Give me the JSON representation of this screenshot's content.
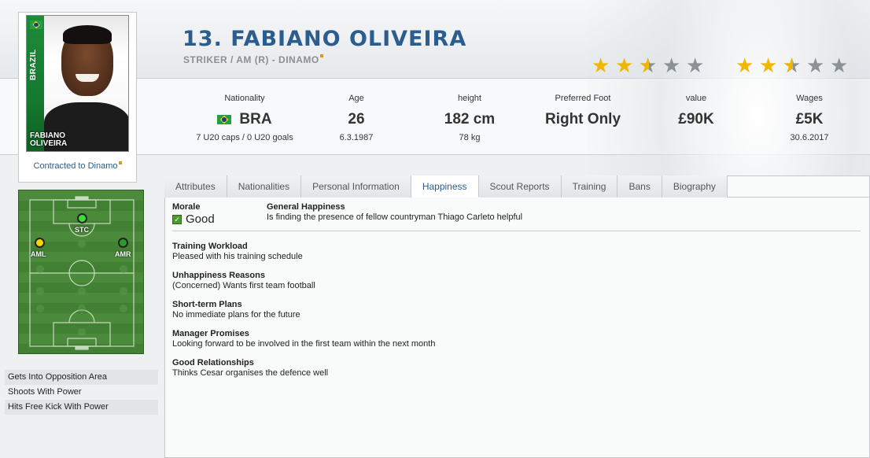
{
  "player": {
    "title": "13. FABIANO OLIVEIRA",
    "subtitle": "STRIKER / AM (R) - DINAMO",
    "photo_name_line1": "FABIANO",
    "photo_name_line2": "OLIVEIRA",
    "photo_country": "BRAZIL",
    "contracted": "Contracted to Dinamo",
    "current_ability_stars": 2.5,
    "potential_ability_stars": 2.5
  },
  "info": {
    "nationality_label": "Nationality",
    "nationality_value": "BRA",
    "nationality_sub": "7 U20 caps / 0 U20 goals",
    "age_label": "Age",
    "age_value": "26",
    "age_sub": "6.3.1987",
    "height_label": "height",
    "height_value": "182 cm",
    "height_sub": "78 kg",
    "foot_label": "Preferred Foot",
    "foot_value": "Right Only",
    "value_label": "value",
    "value_value": "£90K",
    "wages_label": "Wages",
    "wages_value": "£5K",
    "wages_sub": "30.6.2017"
  },
  "pitch": {
    "positions": [
      {
        "label": "STC",
        "color": "#3cdc3c"
      },
      {
        "label": "AML",
        "color": "#f0d800"
      },
      {
        "label": "AMR",
        "color": "#2e9a2e"
      }
    ]
  },
  "traits": [
    "Gets Into Opposition Area",
    "Shoots With Power",
    "Hits Free Kick With Power"
  ],
  "tabs": [
    "Attributes",
    "Nationalities",
    "Personal Information",
    "Happiness",
    "Scout Reports",
    "Training",
    "Bans",
    "Biography"
  ],
  "active_tab": "Happiness",
  "happiness": {
    "morale_label": "Morale",
    "morale_value": "Good",
    "general_label": "General Happiness",
    "general_text": "Is finding the presence of fellow countryman Thiago Carleto helpful",
    "sections": [
      {
        "heading": "Training Workload",
        "text": "Pleased with his training schedule"
      },
      {
        "heading": "Unhappiness Reasons",
        "text": "(Concerned) Wants first team football"
      },
      {
        "heading": "Short-term Plans",
        "text": "No immediate plans for the future"
      },
      {
        "heading": "Manager Promises",
        "text": "Looking forward to be involved in the first team within the next month"
      },
      {
        "heading": "Good Relationships",
        "text": "Thinks Cesar organises the defence well"
      }
    ]
  }
}
